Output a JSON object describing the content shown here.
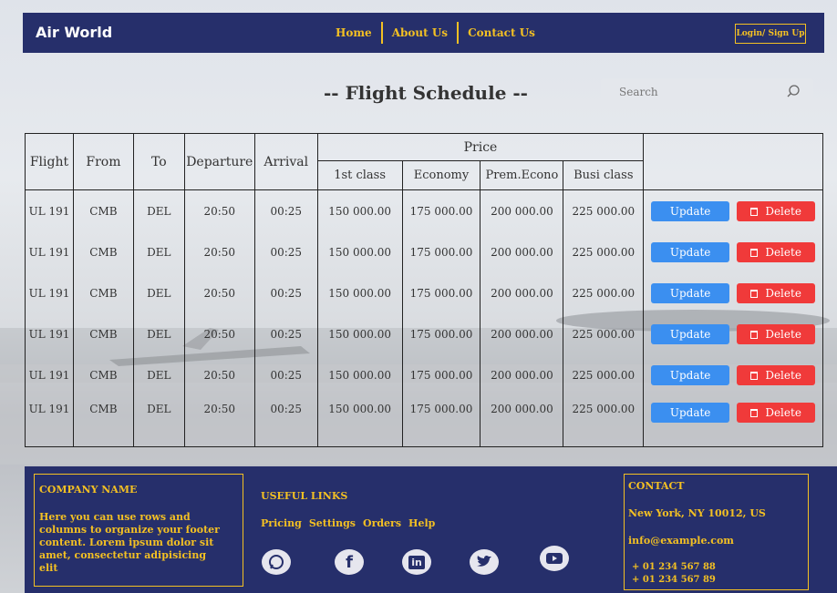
{
  "header": {
    "brand": "Air World",
    "nav": [
      "Home",
      "About Us",
      "Contact Us"
    ],
    "login_label": "Login/ Sign Up"
  },
  "page_title": "-- Flight Schedule --",
  "search": {
    "placeholder": "Search"
  },
  "table": {
    "headers": {
      "flight": "Flight",
      "from": "From",
      "to": "To",
      "departure": "Departure",
      "arrival": "Arrival",
      "price": "Price",
      "first": "1st class",
      "economy": "Economy",
      "prem": "Prem.Econo",
      "busi": "Busi class"
    },
    "rows": [
      [
        "UL 191",
        "CMB",
        "DEL",
        "20:50",
        "00:25",
        "150 000.00",
        "175 000.00",
        "200 000.00",
        "225 000.00"
      ],
      [
        "UL 191",
        "CMB",
        "DEL",
        "20:50",
        "00:25",
        "150 000.00",
        "175 000.00",
        "200 000.00",
        "225 000.00"
      ],
      [
        "UL 191",
        "CMB",
        "DEL",
        "20:50",
        "00:25",
        "150 000.00",
        "175 000.00",
        "200 000.00",
        "225 000.00"
      ],
      [
        "UL 191",
        "CMB",
        "DEL",
        "20:50",
        "00:25",
        "150 000.00",
        "175 000.00",
        "200 000.00",
        "225 000.00"
      ],
      [
        "UL 191",
        "CMB",
        "DEL",
        "20:50",
        "00:25",
        "150 000.00",
        "175 000.00",
        "200 000.00",
        "225 000.00"
      ],
      [
        "UL 191",
        "CMB",
        "DEL",
        "20:50",
        "00:25",
        "150 000.00",
        "175 000.00",
        "200 000.00",
        "225 000.00"
      ]
    ],
    "update_label": "Update",
    "delete_label": "Delete"
  },
  "footer": {
    "company_heading": "COMPANY NAME",
    "company_text": "Here you can use rows and columns to organize your footer content. Lorem ipsum dolor sit amet, consectetur adipisicing elit",
    "links_heading": "USEFUL LINKS",
    "links": [
      "Pricing",
      "Settings",
      "Orders",
      "Help"
    ],
    "social": [
      "whatsapp-icon",
      "facebook-icon",
      "linkedin-icon",
      "twitter-icon",
      "youtube-icon"
    ],
    "contact_heading": "CONTACT",
    "address": "New York, NY 10012, US",
    "email": "info@example.com",
    "phone1": "+ 01 234 567 88",
    "phone2": "+ 01 234 567 89"
  },
  "colors": {
    "navy": "#262f6b",
    "gold": "#f3c023",
    "update": "#3b8ff0",
    "delete": "#f03a3a"
  }
}
